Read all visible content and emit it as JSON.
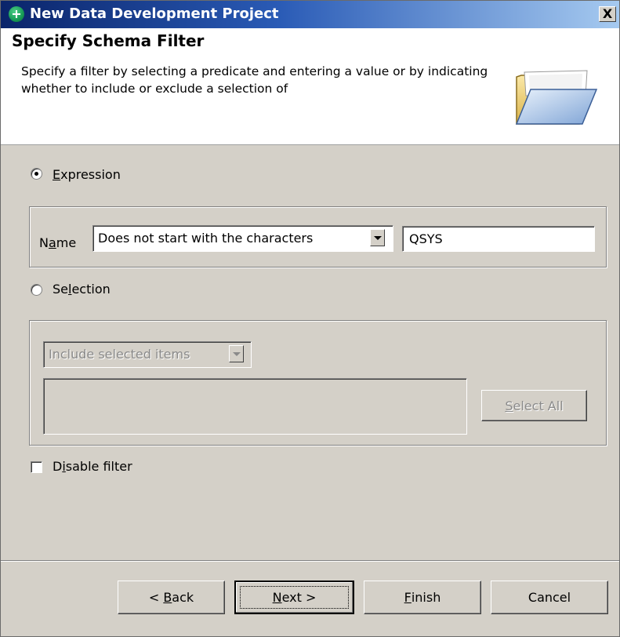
{
  "window": {
    "title": "New Data Development Project",
    "close_label": "X"
  },
  "header": {
    "title": "Specify Schema Filter",
    "description": "Specify a filter by selecting a predicate and entering a value or by indicating whether to include or exclude a selection of",
    "icon": "open-folder-icon"
  },
  "expression": {
    "label_pre": "",
    "label_mnemonic": "E",
    "label_post": "xpression",
    "selected": true,
    "name_label_pre": "N",
    "name_label_mnemonic": "a",
    "name_label_post": "me",
    "predicate_value": "Does not start with the characters",
    "text_value": "QSYS"
  },
  "selection": {
    "label_pre": "Se",
    "label_mnemonic": "l",
    "label_post": "ection",
    "selected": false,
    "mode_value": "Include selected items",
    "select_all_pre": "",
    "select_all_mnemonic": "S",
    "select_all_post": "elect All"
  },
  "disable_filter": {
    "label_pre": "D",
    "label_mnemonic": "i",
    "label_post": "sable filter",
    "checked": false
  },
  "buttons": {
    "back_pre": "< ",
    "back_mnemonic": "B",
    "back_post": "ack",
    "next_pre": "",
    "next_mnemonic": "N",
    "next_post": "ext >",
    "finish_pre": "",
    "finish_mnemonic": "F",
    "finish_post": "inish",
    "cancel": "Cancel"
  },
  "colors": {
    "title_bar_start": "#0a246a",
    "title_bar_end": "#a6caf0",
    "dialog_face": "#d4d0c8"
  }
}
